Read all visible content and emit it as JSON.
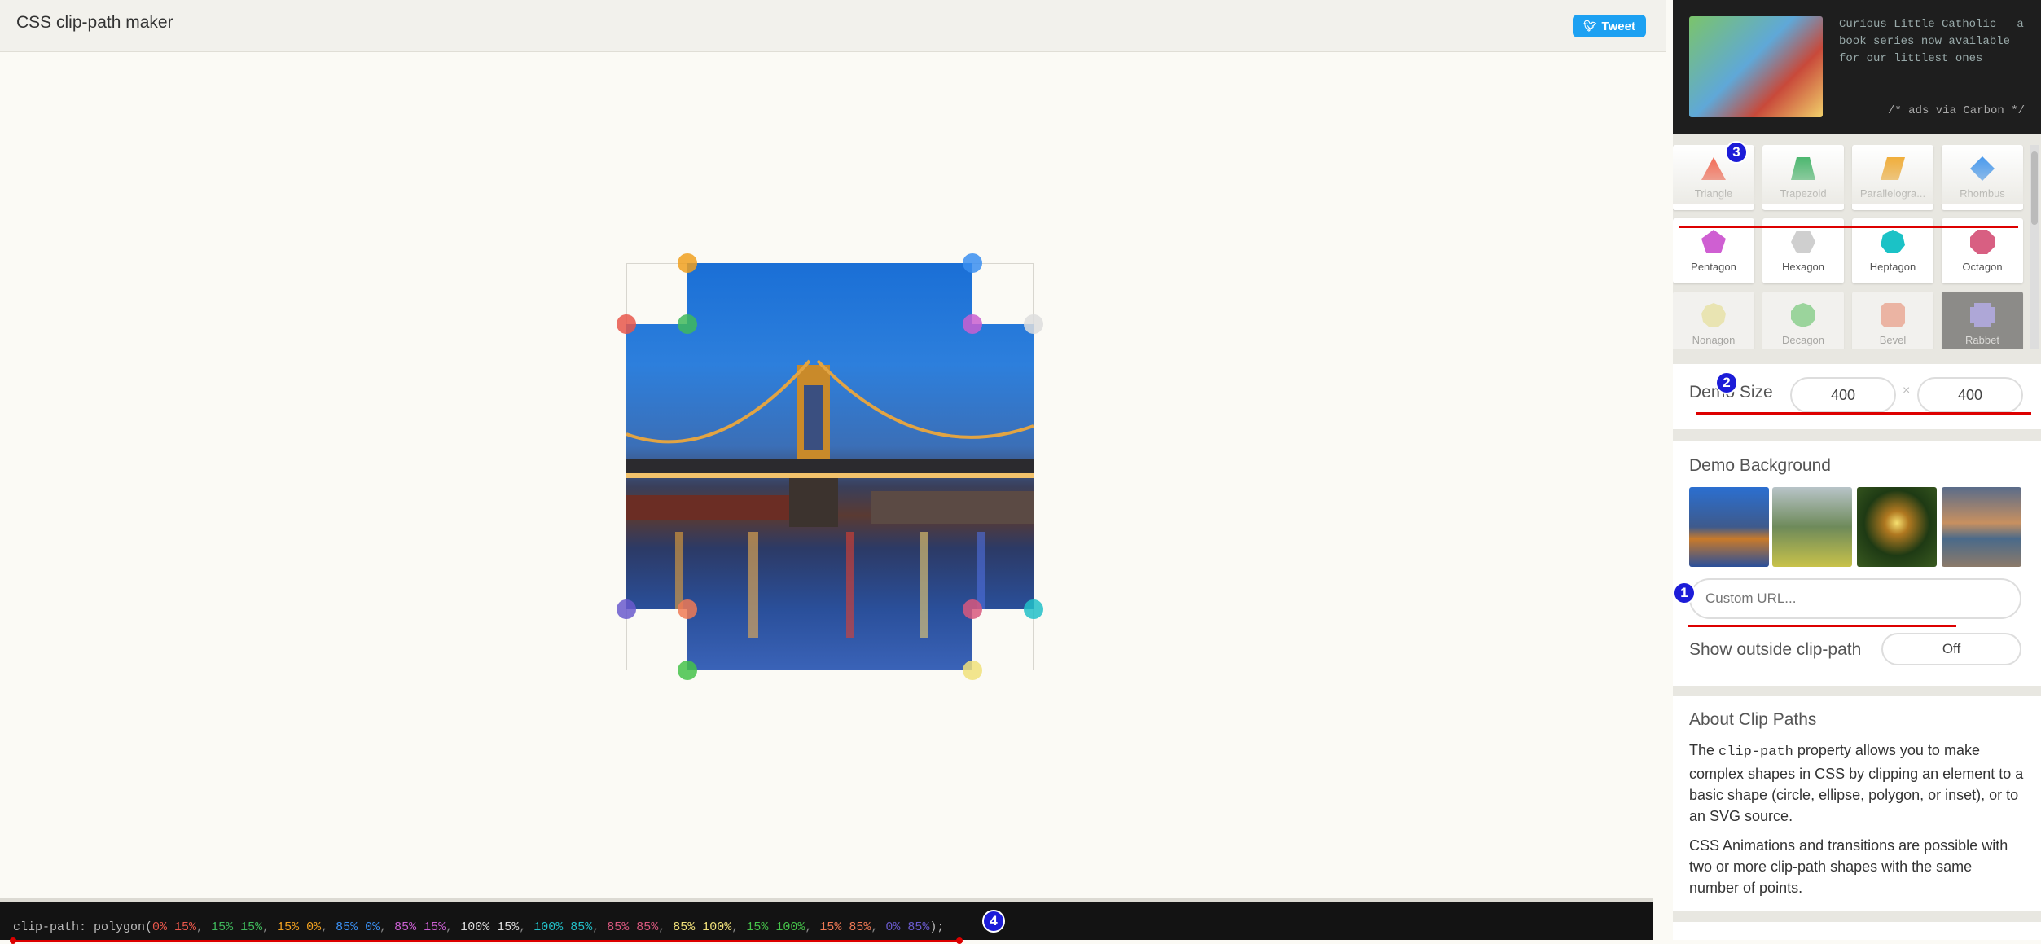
{
  "header": {
    "title": "CSS clip-path maker",
    "tweet_label": "Tweet"
  },
  "output": {
    "prefix": "clip-path: polygon(",
    "points": [
      {
        "text": "0% 15%",
        "color": "#e8574b"
      },
      {
        "text": "15% 15%",
        "color": "#3fb95c"
      },
      {
        "text": "15% 0%",
        "color": "#f0a020"
      },
      {
        "text": "85% 0%",
        "color": "#3a8ef0"
      },
      {
        "text": "85% 15%",
        "color": "#c95fd0"
      },
      {
        "text": "100% 15%",
        "color": "#dddddd"
      },
      {
        "text": "100% 85%",
        "color": "#22c0c8"
      },
      {
        "text": "85% 85%",
        "color": "#d8587e"
      },
      {
        "text": "85% 100%",
        "color": "#f0e07a"
      },
      {
        "text": "15% 100%",
        "color": "#45c24a"
      },
      {
        "text": "15% 85%",
        "color": "#f07a55"
      },
      {
        "text": "0% 85%",
        "color": "#6a5acd"
      }
    ],
    "suffix": ");"
  },
  "badges": {
    "b1": "1",
    "b2": "2",
    "b3": "3",
    "b4": "4"
  },
  "ad": {
    "text": "Curious Little Catholic — a book series now available for our littlest ones",
    "credit": "/* ads via Carbon */"
  },
  "shapes": [
    {
      "label": "Triangle",
      "color": "#f4543c",
      "icon": "triangle-icon"
    },
    {
      "label": "Trapezoid",
      "color": "#2fae5a",
      "icon": "trapezoid-icon"
    },
    {
      "label": "Parallelogra...",
      "color": "#f2a31c",
      "icon": "parallelogram-icon"
    },
    {
      "label": "Rhombus",
      "color": "#2d8cf0",
      "icon": "rhombus-icon"
    },
    {
      "label": "Pentagon",
      "color": "#cf5fd2",
      "icon": "pentagon-icon"
    },
    {
      "label": "Hexagon",
      "color": "#cfcfcf",
      "icon": "hexagon-icon"
    },
    {
      "label": "Heptagon",
      "color": "#1bc2c6",
      "icon": "heptagon-icon"
    },
    {
      "label": "Octagon",
      "color": "#d85f82",
      "icon": "octagon-icon"
    },
    {
      "label": "Nonagon",
      "color": "#ece27a",
      "icon": "nonagon-icon"
    },
    {
      "label": "Decagon",
      "color": "#3fbf4a",
      "icon": "decagon-icon"
    },
    {
      "label": "Bevel",
      "color": "#f0785a",
      "icon": "bevel-icon"
    },
    {
      "label": "Rabbet",
      "color": "#6a5acd",
      "icon": "rabbet-icon"
    }
  ],
  "demo_size": {
    "label": "Demo Size",
    "width": "400",
    "height": "400",
    "separator": "×"
  },
  "background": {
    "title": "Demo Background",
    "custom_url_placeholder": "Custom URL...",
    "outside_label": "Show outside clip-path",
    "outside_value": "Off"
  },
  "about": {
    "title": "About Clip Paths",
    "p1_before": "The ",
    "p1_code": "clip-path",
    "p1_after": " property allows you to make complex shapes in CSS by clipping an element to a basic shape (circle, ellipse, polygon, or inset), or to an SVG source.",
    "p2": "CSS Animations and transitions are possible with two or more clip-path shapes with the same number of points."
  }
}
